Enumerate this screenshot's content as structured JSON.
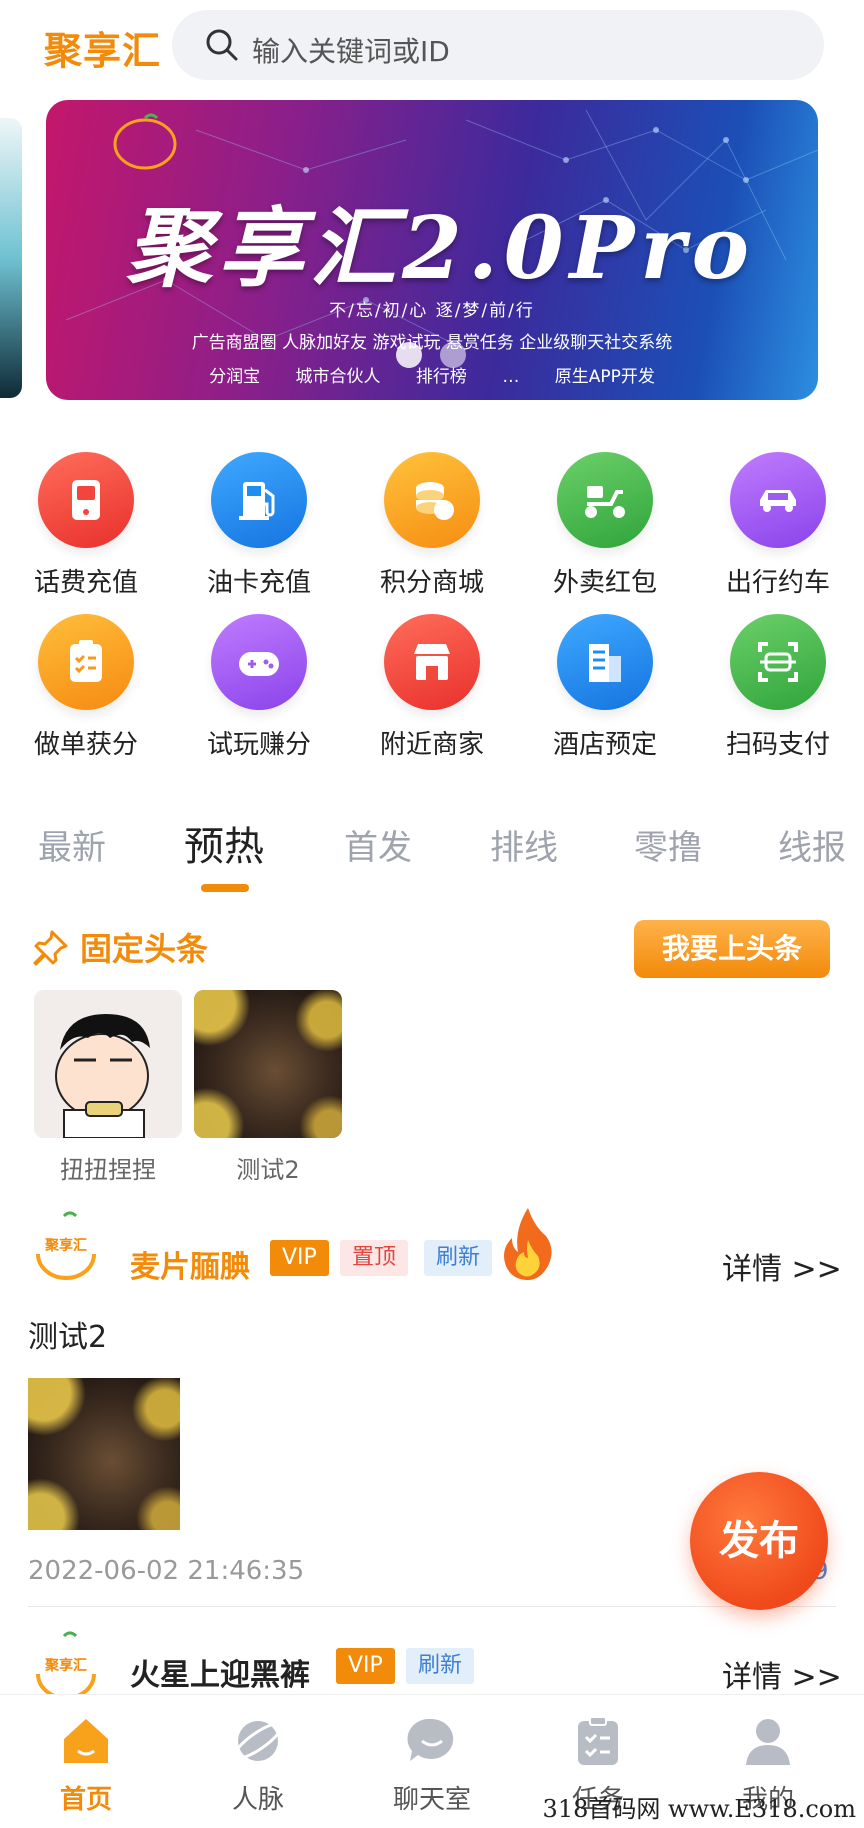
{
  "header": {
    "brand": "聚享汇",
    "search_placeholder": "输入关键词或ID"
  },
  "banner": {
    "logo_text": "聚享汇",
    "headline": "聚享汇2.0Pro",
    "slogan": "不/忘/初/心 逐/梦/前/行",
    "features_line1": "广告商盟圈 人脉加好友 游戏试玩 悬赏任务 企业级聊天社交系统",
    "features_line2": "分润宝 城市合伙人 排行榜 … 原生APP开发",
    "dots": 2
  },
  "grid": {
    "items": [
      {
        "label": "话费充值",
        "icon": "phone-bill-icon",
        "color": "#f2453d"
      },
      {
        "label": "油卡充值",
        "icon": "fuel-pump-icon",
        "color": "#1e8ff0"
      },
      {
        "label": "积分商城",
        "icon": "coins-icon",
        "color": "#f7a21a"
      },
      {
        "label": "外卖红包",
        "icon": "scooter-icon",
        "color": "#42b64a"
      },
      {
        "label": "出行约车",
        "icon": "car-icon",
        "color": "#9d5cf0"
      },
      {
        "label": "做单获分",
        "icon": "clipboard-icon",
        "color": "#f79a1c"
      },
      {
        "label": "试玩赚分",
        "icon": "gamepad-icon",
        "color": "#a25cf0"
      },
      {
        "label": "附近商家",
        "icon": "store-icon",
        "color": "#f04a3c"
      },
      {
        "label": "酒店预定",
        "icon": "building-icon",
        "color": "#1e8ff0"
      },
      {
        "label": "扫码支付",
        "icon": "scan-icon",
        "color": "#3fb64a"
      }
    ]
  },
  "tabs": [
    "最新",
    "预热",
    "首发",
    "排线",
    "零撸",
    "线报"
  ],
  "active_tab": "预热",
  "pinned": {
    "title": "固定头条",
    "button": "我要上头条",
    "items": [
      {
        "label": "扭扭捏捏"
      },
      {
        "label": "测试2"
      }
    ]
  },
  "posts": [
    {
      "avatar_text": "聚享汇",
      "name": "麦片腼腆",
      "badges": [
        "VIP",
        "置顶",
        "刷新"
      ],
      "detail": "详情 >>",
      "text": "测试2",
      "time": "2022-06-02 21:46:35",
      "count": "9"
    },
    {
      "avatar_text": "聚享汇",
      "name": "火星上迎黑裤",
      "badges": [
        "VIP",
        "刷新"
      ],
      "detail": "详情 >>"
    }
  ],
  "publish_button": "发布",
  "nav": {
    "items": [
      {
        "label": "首页",
        "icon": "home-icon"
      },
      {
        "label": "人脉",
        "icon": "planet-icon"
      },
      {
        "label": "聊天室",
        "icon": "chat-icon"
      },
      {
        "label": "任务",
        "icon": "task-icon"
      },
      {
        "label": "我的",
        "icon": "user-icon"
      }
    ],
    "active": "首页"
  },
  "colors": {
    "accent": "#f28a0a",
    "nav_inactive": "#b8bcc4"
  },
  "watermark": "318首码网 www.E318.com"
}
